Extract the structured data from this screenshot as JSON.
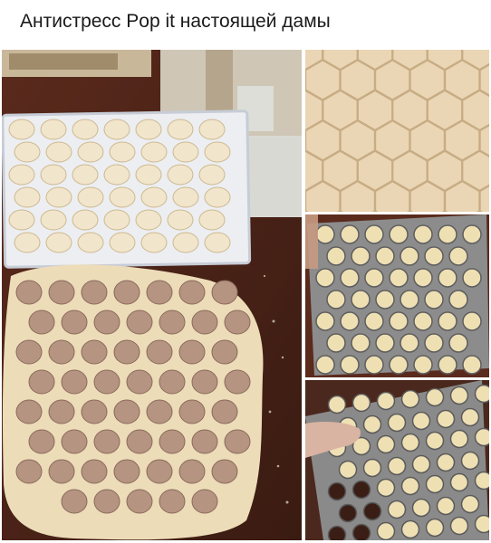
{
  "caption": {
    "text": "Антистресс Pop it настоящей дамы"
  },
  "photos": {
    "main": {
      "icon": "dumplings-on-table-photo"
    },
    "top_right": {
      "icon": "hexagon-dough-cut-photo"
    },
    "middle_right": {
      "icon": "dumpling-mold-photo"
    },
    "bottom_right": {
      "icon": "dumpling-mold-hand-photo"
    }
  },
  "colors": {
    "dough": "#ecdcb8",
    "table": "#4a2418",
    "metal": "#8c8c8c",
    "meat": "#b59482"
  }
}
